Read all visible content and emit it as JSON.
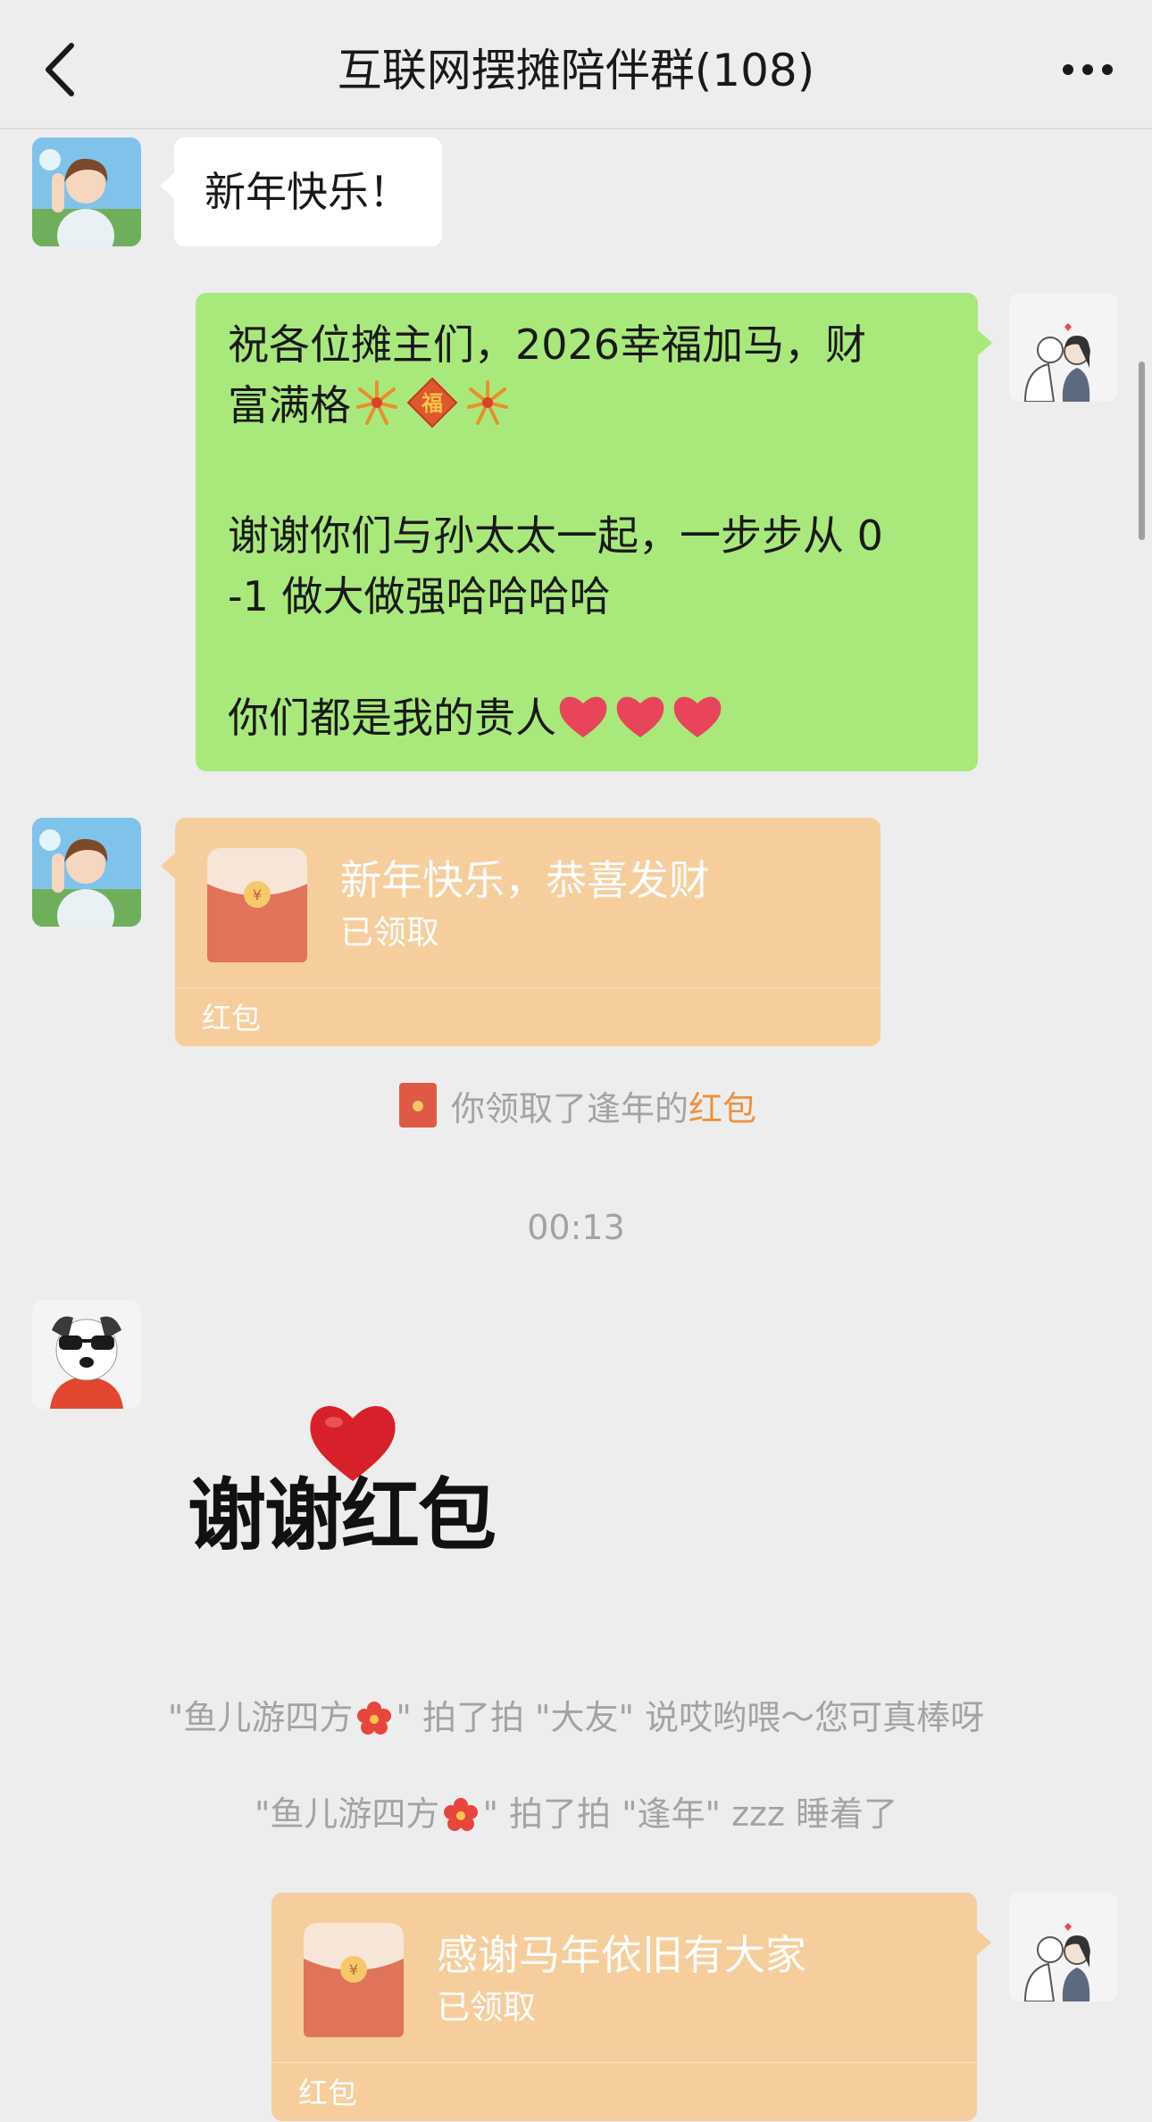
{
  "header": {
    "title": "互联网摆摊陪伴群(108)"
  },
  "messages": {
    "m1": {
      "text": "新年快乐！"
    },
    "m2": {
      "line1": "祝各位摊主们，2026幸福加马，财",
      "line2": "富满格",
      "line2_emojis": [
        "fireworks-emoji",
        "fu-diamond-emoji",
        "fireworks-emoji"
      ],
      "para2": "谢谢你们与孙太太一起，一步步从 0\n-1 做大做强哈哈哈哈",
      "para3": "你们都是我的贵人",
      "para3_emojis": [
        "heart-emoji",
        "heart-emoji",
        "heart-emoji"
      ]
    },
    "packet1": {
      "title": "新年快乐，恭喜发财",
      "status": "已领取",
      "label": "红包"
    },
    "notice1": {
      "prefix": "你领取了逢年的",
      "link": "红包"
    },
    "time": "00:13",
    "sticker": {
      "text": "谢谢红包"
    },
    "pat1": {
      "part1": "\"鱼儿游四方",
      "part2": "\" 拍了拍 \"大友\" 说哎哟喂～您可真棒呀"
    },
    "pat2": {
      "part1": "\"鱼儿游四方",
      "part2": "\" 拍了拍 \"逢年\" zzz 睡着了"
    },
    "packet2": {
      "title": "感谢马年依旧有大家",
      "status": "已领取",
      "label": "红包"
    }
  },
  "colors": {
    "background": "#EDEDED",
    "self_bubble": "#A9E97B",
    "red_packet": "#F6CE9D",
    "highlight": "#F0913D"
  },
  "icons": [
    "back-arrow-icon",
    "more-icon",
    "red-packet-icon",
    "flower-icon"
  ]
}
